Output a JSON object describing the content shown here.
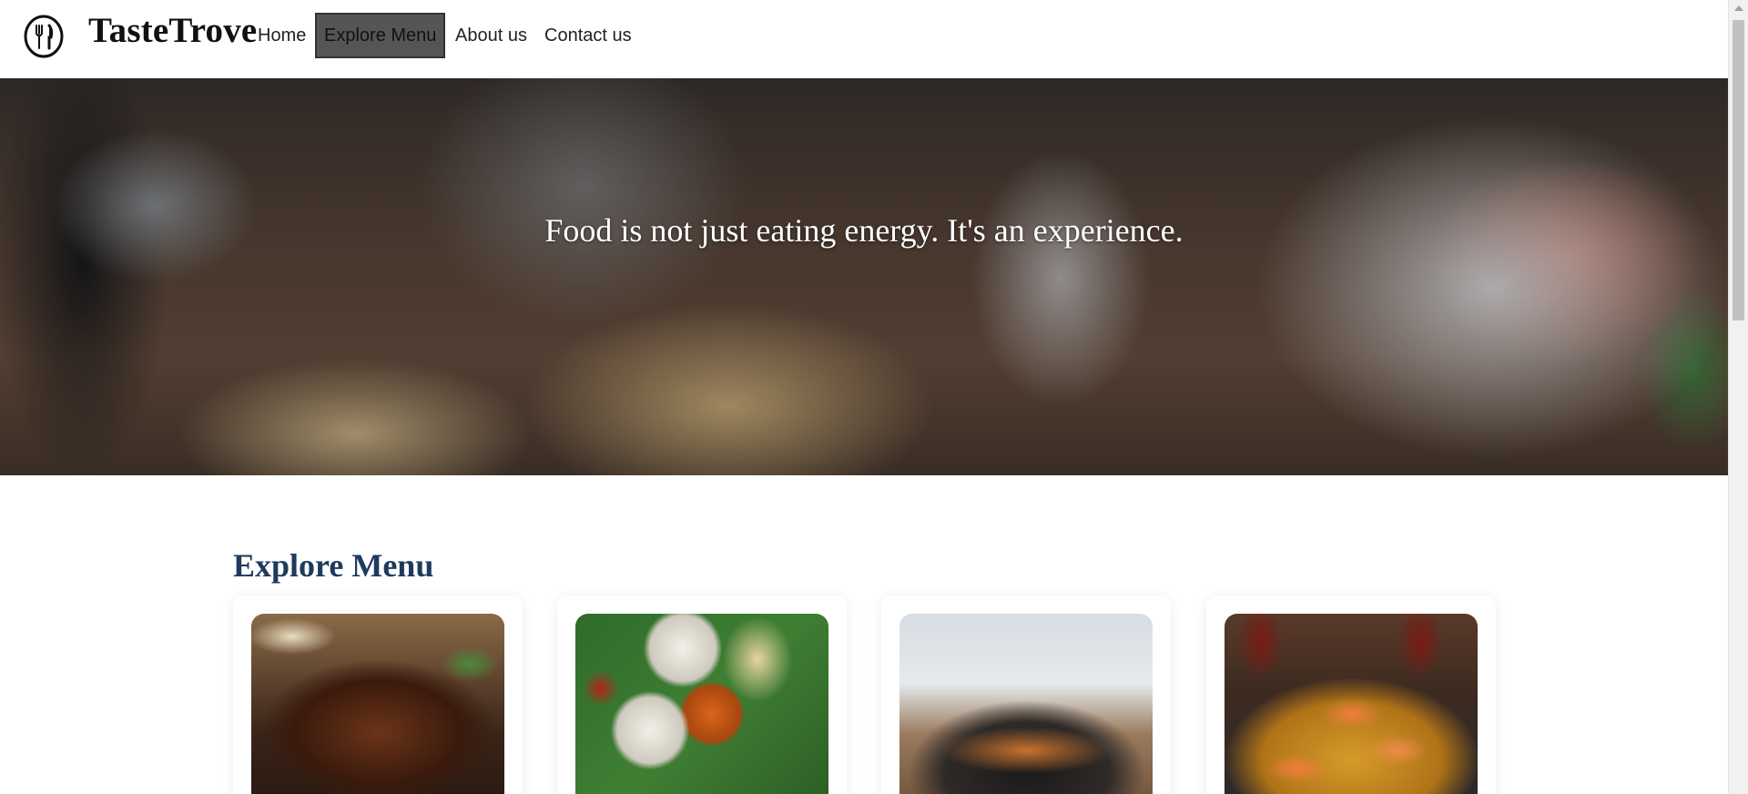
{
  "header": {
    "brand": "TasteTrove",
    "logo_icon": "fork-and-knife-icon",
    "nav": [
      {
        "label": "Home",
        "active": false
      },
      {
        "label": "Explore Menu",
        "active": true
      },
      {
        "label": "About us",
        "active": false
      },
      {
        "label": "Contact us",
        "active": false
      }
    ]
  },
  "hero": {
    "quote": "Food is not just eating energy. It's an experience."
  },
  "explore": {
    "title": "Explore Menu",
    "title_color": "#1e3a5f",
    "cards": [
      {
        "image": "curry-dish-image"
      },
      {
        "image": "thali-platter-image"
      },
      {
        "image": "vegetable-soup-image"
      },
      {
        "image": "seafood-paella-image"
      }
    ]
  },
  "colors": {
    "active_nav_bg": "#555555",
    "hero_text": "#ffffff"
  }
}
